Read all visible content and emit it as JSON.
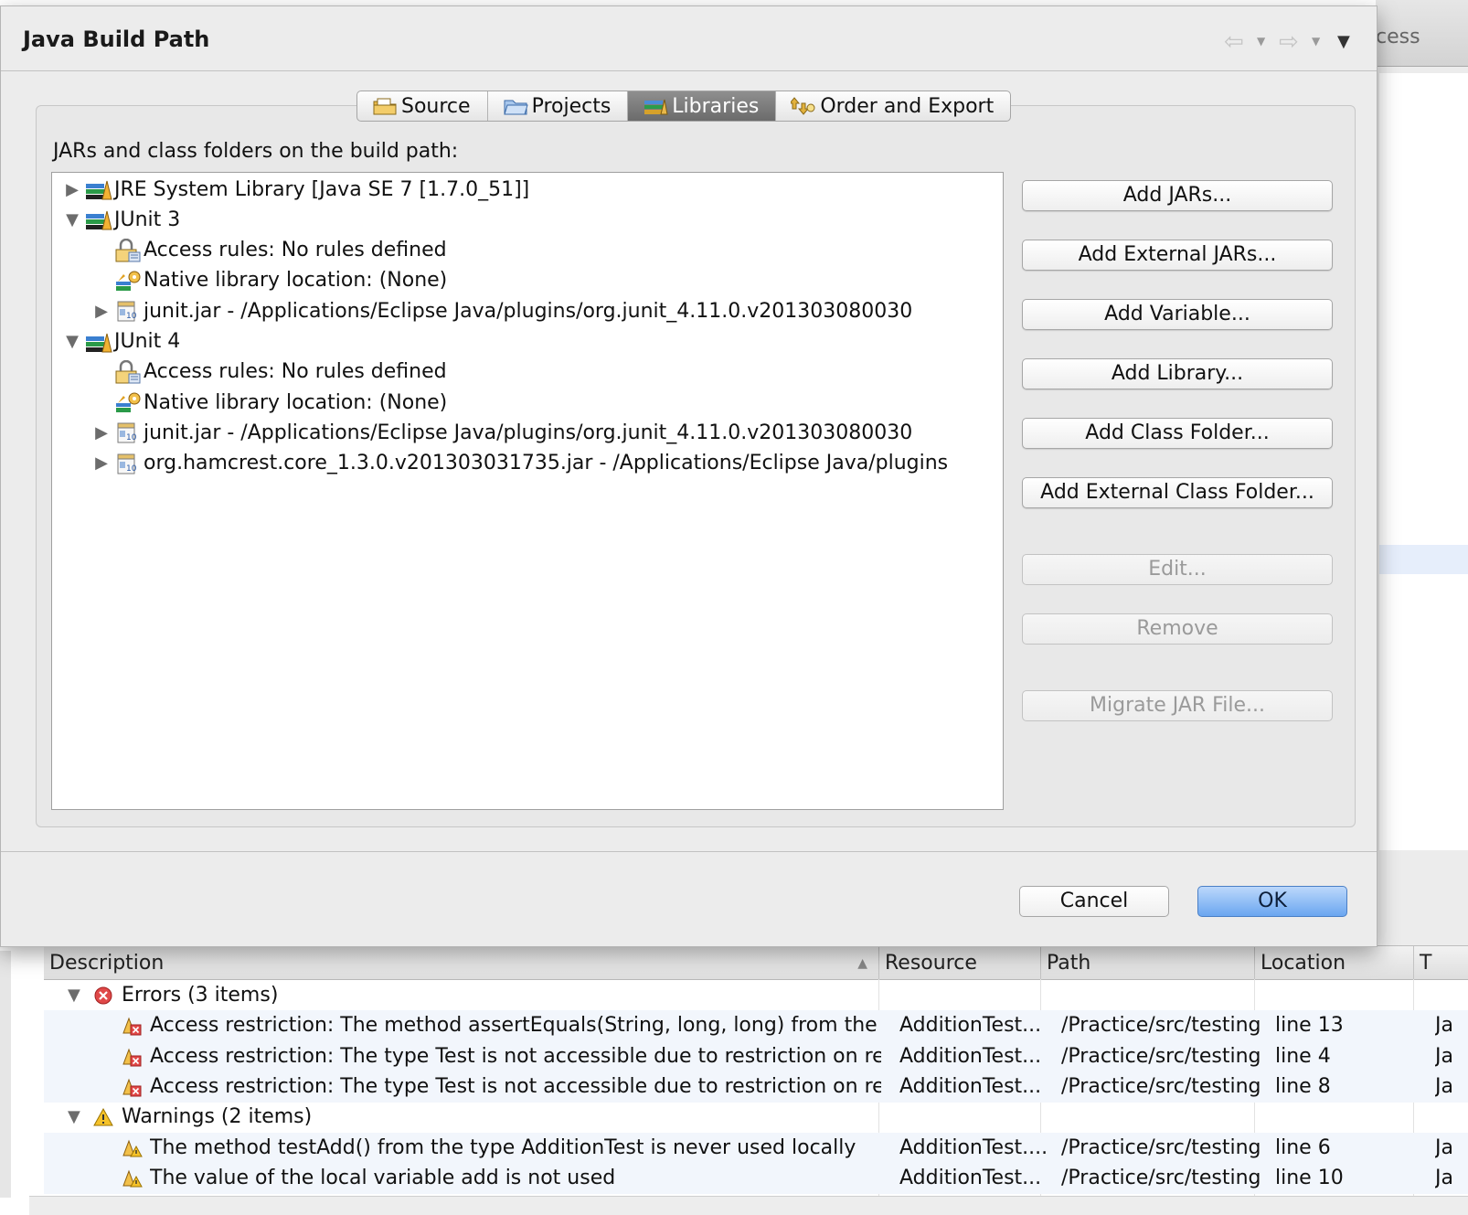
{
  "background": {
    "search_fragment": "cess"
  },
  "dialog": {
    "title": "Java Build Path",
    "tabs": [
      {
        "label": "Source",
        "icon": "source-folder-icon"
      },
      {
        "label": "Projects",
        "icon": "projects-folder-icon"
      },
      {
        "label": "Libraries",
        "icon": "libraries-icon",
        "active": true
      },
      {
        "label": "Order and Export",
        "icon": "order-export-icon"
      }
    ],
    "list_label": "JARs and class folders on the build path:",
    "tree": [
      {
        "label": "JRE System Library [Java SE 7 [1.7.0_51]]",
        "level": 0,
        "state": "collapsed",
        "icon": "library-icon"
      },
      {
        "label": "JUnit 3",
        "level": 0,
        "state": "expanded",
        "icon": "library-icon"
      },
      {
        "label": "Access rules: No rules defined",
        "level": 1,
        "state": "none",
        "icon": "access-rules-icon"
      },
      {
        "label": "Native library location: (None)",
        "level": 1,
        "state": "none",
        "icon": "native-library-icon"
      },
      {
        "label": "junit.jar - /Applications/Eclipse Java/plugins/org.junit_4.11.0.v201303080030",
        "level": 1,
        "state": "collapsed",
        "icon": "jar-icon"
      },
      {
        "label": "JUnit 4",
        "level": 0,
        "state": "expanded",
        "icon": "library-icon"
      },
      {
        "label": "Access rules: No rules defined",
        "level": 1,
        "state": "none",
        "icon": "access-rules-icon"
      },
      {
        "label": "Native library location: (None)",
        "level": 1,
        "state": "none",
        "icon": "native-library-icon"
      },
      {
        "label": "junit.jar - /Applications/Eclipse Java/plugins/org.junit_4.11.0.v201303080030",
        "level": 1,
        "state": "collapsed",
        "icon": "jar-icon"
      },
      {
        "label": "org.hamcrest.core_1.3.0.v201303031735.jar - /Applications/Eclipse Java/plugins",
        "level": 1,
        "state": "collapsed",
        "icon": "jar-icon"
      }
    ],
    "buttons": {
      "add_jars": "Add JARs...",
      "add_external_jars": "Add External JARs...",
      "add_variable": "Add Variable...",
      "add_library": "Add Library...",
      "add_class_folder": "Add Class Folder...",
      "add_external_class_folder": "Add External Class Folder...",
      "edit": "Edit...",
      "remove": "Remove",
      "migrate_jar": "Migrate JAR File..."
    },
    "cancel": "Cancel",
    "ok": "OK"
  },
  "problems": {
    "columns": [
      "Description",
      "Resource",
      "Path",
      "Location",
      "T"
    ],
    "rows": [
      {
        "kind": "group",
        "icon": "error-icon",
        "description": "Errors (3 items)"
      },
      {
        "kind": "item",
        "icon": "error-marker-icon",
        "description": "Access restriction: The method assertEquals(String, long, long) from the ty...",
        "resource": "AdditionTest...",
        "path": "/Practice/src/testing",
        "location": "line 13",
        "type": "Ja"
      },
      {
        "kind": "item",
        "icon": "error-marker-icon",
        "description": "Access restriction: The type Test is not accessible due to restriction on req...",
        "resource": "AdditionTest...",
        "path": "/Practice/src/testing",
        "location": "line 4",
        "type": "Ja"
      },
      {
        "kind": "item",
        "icon": "error-marker-icon",
        "description": "Access restriction: The type Test is not accessible due to restriction on req...",
        "resource": "AdditionTest...",
        "path": "/Practice/src/testing",
        "location": "line 8",
        "type": "Ja"
      },
      {
        "kind": "group",
        "icon": "warning-icon",
        "description": "Warnings (2 items)"
      },
      {
        "kind": "item",
        "icon": "warning-marker-icon",
        "description": "The method testAdd() from the type AdditionTest is never used locally",
        "resource": "AdditionTest....",
        "path": "/Practice/src/testing",
        "location": "line 6",
        "type": "Ja"
      },
      {
        "kind": "item",
        "icon": "warning-marker-icon",
        "description": "The value of the local variable add is not used",
        "resource": "AdditionTest...",
        "path": "/Practice/src/testing",
        "location": "line 10",
        "type": "Ja"
      }
    ]
  },
  "colors": {
    "dialog_bg": "#ececec",
    "ok_button": "#6aa6f0",
    "active_tab": "#7a7a7a",
    "error": "#d93a3a",
    "warning": "#f0b400"
  }
}
